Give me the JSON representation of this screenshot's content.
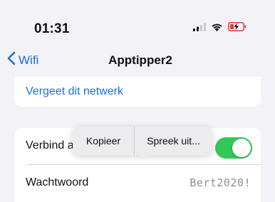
{
  "status_bar": {
    "time": "01:31",
    "signal_icon": "cellular-signal-icon",
    "wifi_icon": "wifi-icon",
    "battery_icon": "battery-charging-icon"
  },
  "nav": {
    "back_label": "Wifi",
    "back_icon": "chevron-left-icon",
    "title": "Apptipper2"
  },
  "actions": {
    "forget_label": "Vergeet dit netwerk"
  },
  "settings": {
    "auto_join_label": "Verbind a",
    "auto_join_on": true,
    "password_label": "Wachtwoord",
    "password_value": "Bert2020!"
  },
  "edit_menu": {
    "copy_label": "Kopieer",
    "speak_label": "Spreek uit..."
  },
  "colors": {
    "accent": "#1a6fe0",
    "toggle_on": "#34c759",
    "background": "#f2f2f7"
  }
}
